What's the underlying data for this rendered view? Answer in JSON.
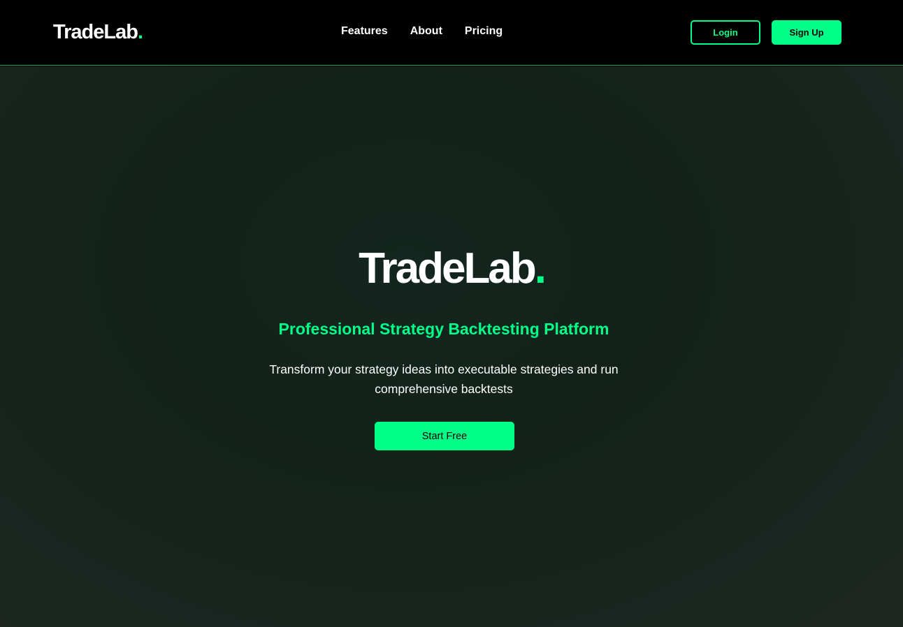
{
  "navbar": {
    "brand": {
      "name": "TradeLab",
      "dot": "."
    },
    "links": [
      "Features",
      "About",
      "Pricing"
    ],
    "login_label": "Login",
    "signup_label": "Sign Up"
  },
  "hero": {
    "title": {
      "name": "TradeLab",
      "dot": "."
    },
    "subtitle": "Professional Strategy Backtesting Platform",
    "description": "Transform your strategy ideas into executable strategies and run comprehensive backtests",
    "cta_label": "Start Free"
  },
  "colors": {
    "accent": "#00ff88",
    "background": "#000000",
    "hero_background": "#132219"
  }
}
